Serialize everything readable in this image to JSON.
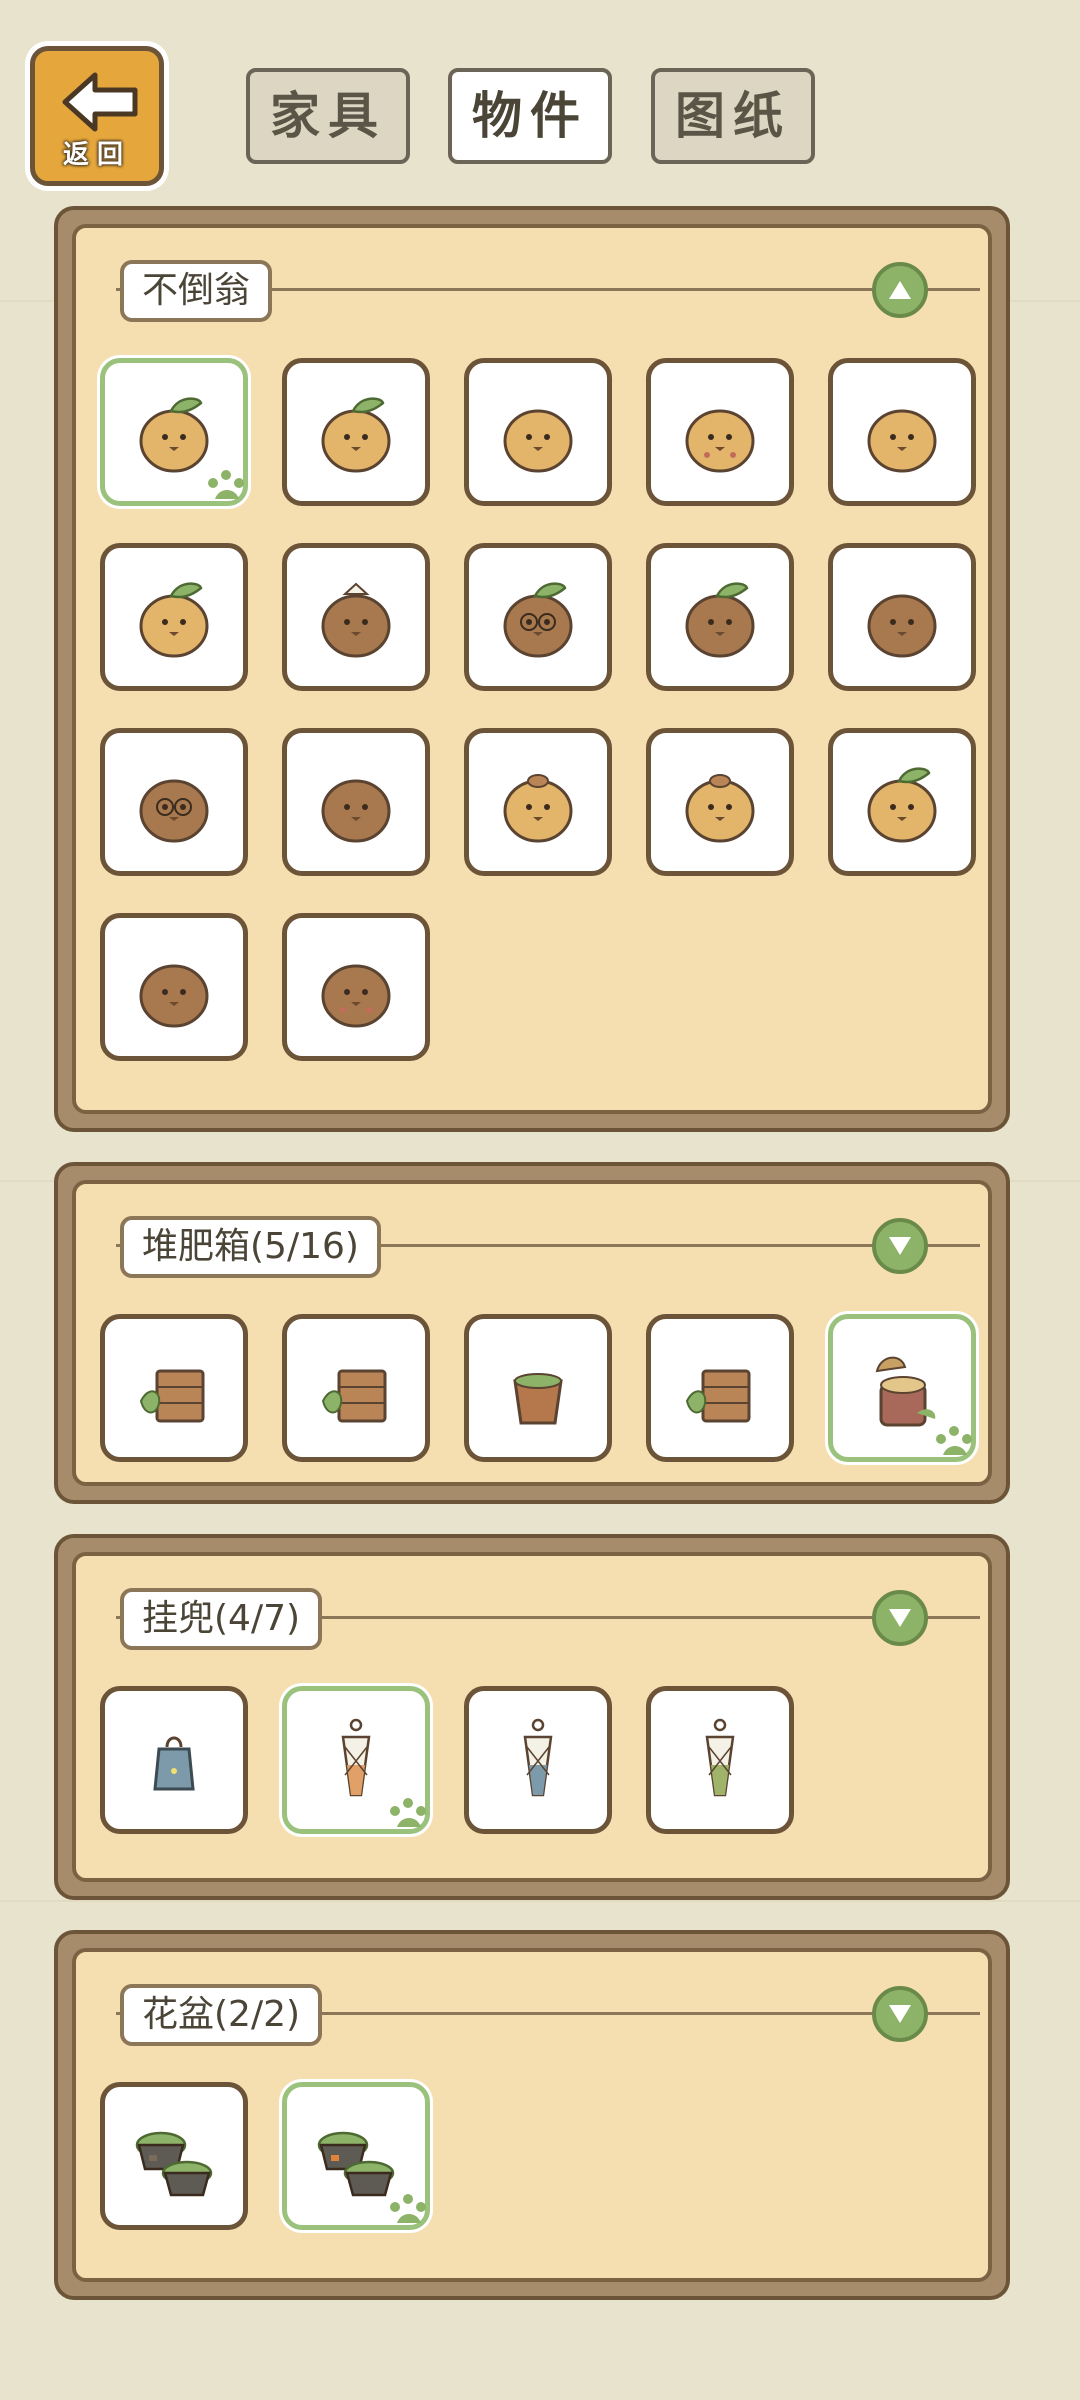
{
  "header": {
    "back_label": "返回",
    "tabs": [
      {
        "label": "家具",
        "active": false
      },
      {
        "label": "物件",
        "active": true
      },
      {
        "label": "图纸",
        "active": false
      }
    ]
  },
  "sections": [
    {
      "title": "不倒翁",
      "expanded": true,
      "items": [
        {
          "icon": "tumbler-leaf-icon",
          "selected": true
        },
        {
          "icon": "tumbler-leaf-icon",
          "selected": false
        },
        {
          "icon": "tumbler-wink-icon",
          "selected": false
        },
        {
          "icon": "tumbler-heart-icon",
          "selected": false
        },
        {
          "icon": "tumbler-shell-icon",
          "selected": false
        },
        {
          "icon": "tumbler-sprout-icon",
          "selected": false
        },
        {
          "icon": "tumbler-flower-icon",
          "selected": false
        },
        {
          "icon": "tumbler-glasses-icon",
          "selected": false
        },
        {
          "icon": "tumbler-leafwrap-icon",
          "selected": false
        },
        {
          "icon": "tumbler-dark-icon",
          "selected": false
        },
        {
          "icon": "tumbler-spectacles-icon",
          "selected": false
        },
        {
          "icon": "tumbler-sloth-icon",
          "selected": false
        },
        {
          "icon": "tumbler-grumpy-icon",
          "selected": false
        },
        {
          "icon": "tumbler-acorn-icon",
          "selected": false
        },
        {
          "icon": "tumbler-bird-icon",
          "selected": false
        },
        {
          "icon": "tumbler-plain-icon",
          "selected": false
        },
        {
          "icon": "tumbler-heartspot-icon",
          "selected": false
        }
      ]
    },
    {
      "title": "堆肥箱(5/16)",
      "expanded": false,
      "items": [
        {
          "icon": "compost-open-icon",
          "selected": false
        },
        {
          "icon": "compost-crate-icon",
          "selected": false
        },
        {
          "icon": "compost-bucket-icon",
          "selected": false
        },
        {
          "icon": "compost-crate-leaf-icon",
          "selected": false
        },
        {
          "icon": "compost-stump-icon",
          "selected": true
        }
      ]
    },
    {
      "title": "挂兜(4/7)",
      "expanded": false,
      "items": [
        {
          "icon": "hanging-bag-blue-icon",
          "selected": false
        },
        {
          "icon": "hanging-net-orange-icon",
          "selected": true
        },
        {
          "icon": "hanging-net-blue-icon",
          "selected": false
        },
        {
          "icon": "hanging-net-green-icon",
          "selected": false
        }
      ]
    },
    {
      "title": "花盆(2/2)",
      "expanded": false,
      "items": [
        {
          "icon": "moss-pot-stone-icon",
          "selected": false
        },
        {
          "icon": "moss-pot-orange-icon",
          "selected": true
        }
      ]
    }
  ],
  "colors": {
    "background": "#e8e3cd",
    "panel_frame": "#a68c6b",
    "panel_inner": "#f5dfb0",
    "selected_border": "#9ac27c",
    "toggle_green": "#8db368",
    "back_button": "#e5a73c"
  }
}
